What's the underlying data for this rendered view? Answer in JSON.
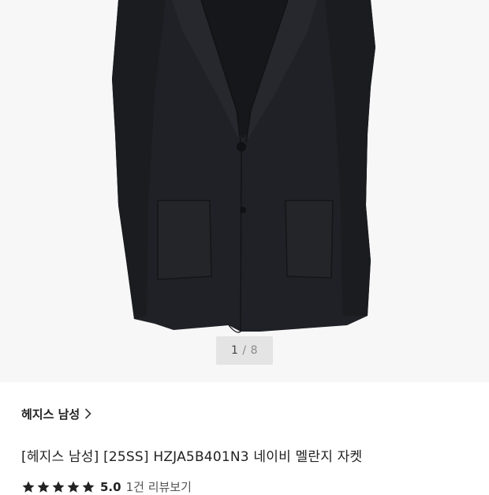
{
  "gallery": {
    "current": "1",
    "separator": "/",
    "total": "8",
    "image_description_icon": "navy-jacket-photo"
  },
  "brand": {
    "name": "헤지스 남성",
    "chevron_icon": "chevron-right-icon"
  },
  "product": {
    "title": "[헤지스 남성] [25SS] HZJA5B401N3 네이비 멜란지 자켓"
  },
  "rating": {
    "stars": 5,
    "max_stars": 5,
    "score": "5.0",
    "review_link": "1건 리뷰보기",
    "star_color": "#222222"
  }
}
